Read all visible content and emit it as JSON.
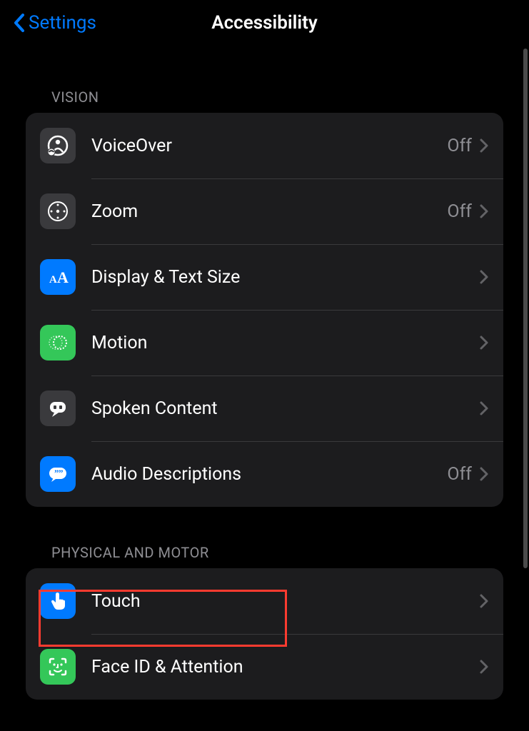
{
  "header": {
    "back_label": "Settings",
    "title": "Accessibility"
  },
  "sections": [
    {
      "title": "VISION",
      "rows": [
        {
          "label": "VoiceOver",
          "value": "Off",
          "icon": "voiceover-icon"
        },
        {
          "label": "Zoom",
          "value": "Off",
          "icon": "zoom-icon"
        },
        {
          "label": "Display & Text Size",
          "value": "",
          "icon": "textsize-icon"
        },
        {
          "label": "Motion",
          "value": "",
          "icon": "motion-icon"
        },
        {
          "label": "Spoken Content",
          "value": "",
          "icon": "spoken-icon"
        },
        {
          "label": "Audio Descriptions",
          "value": "Off",
          "icon": "audiodesc-icon"
        }
      ]
    },
    {
      "title": "PHYSICAL AND MOTOR",
      "rows": [
        {
          "label": "Touch",
          "value": "",
          "icon": "touch-icon"
        },
        {
          "label": "Face ID & Attention",
          "value": "",
          "icon": "faceid-icon"
        }
      ]
    }
  ]
}
